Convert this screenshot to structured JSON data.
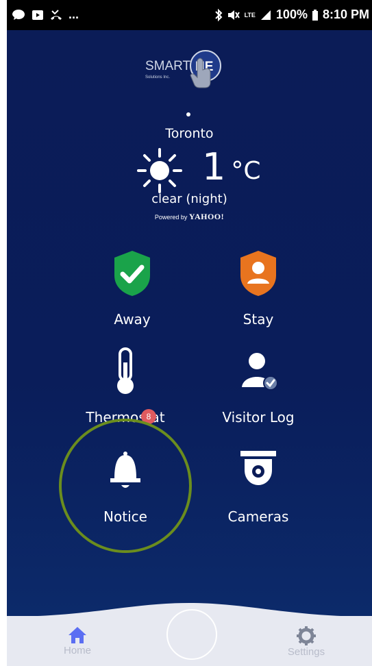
{
  "status_bar": {
    "left_ellipsis": "...",
    "battery_percent": "100%",
    "time": "8:10 PM",
    "network_label": "LTE"
  },
  "logo": {
    "text": "SMARTONE",
    "subtitle": "Solutions Inc."
  },
  "weather": {
    "city": "Toronto",
    "temperature": "1",
    "unit": "°C",
    "condition": "clear (night)",
    "powered_by": "Powered by",
    "provider": "YAHOO!"
  },
  "tiles": [
    {
      "label": "Away",
      "icon": "shield-check-icon",
      "color": "#1aa34a"
    },
    {
      "label": "Stay",
      "icon": "shield-person-icon",
      "color": "#e8741f"
    },
    {
      "label": "Thermostat",
      "icon": "thermometer-icon"
    },
    {
      "label": "Visitor Log",
      "icon": "person-check-icon"
    },
    {
      "label": "Notice",
      "icon": "bell-icon",
      "badge": "8"
    },
    {
      "label": "Cameras",
      "icon": "camera-icon"
    }
  ],
  "nav": {
    "home": "Home",
    "settings": "Settings",
    "active_color": "#5b6ef2"
  },
  "colors": {
    "background": "#0b1c57",
    "highlight_ring": "#6b8d1e",
    "badge": "#e05a5f"
  }
}
